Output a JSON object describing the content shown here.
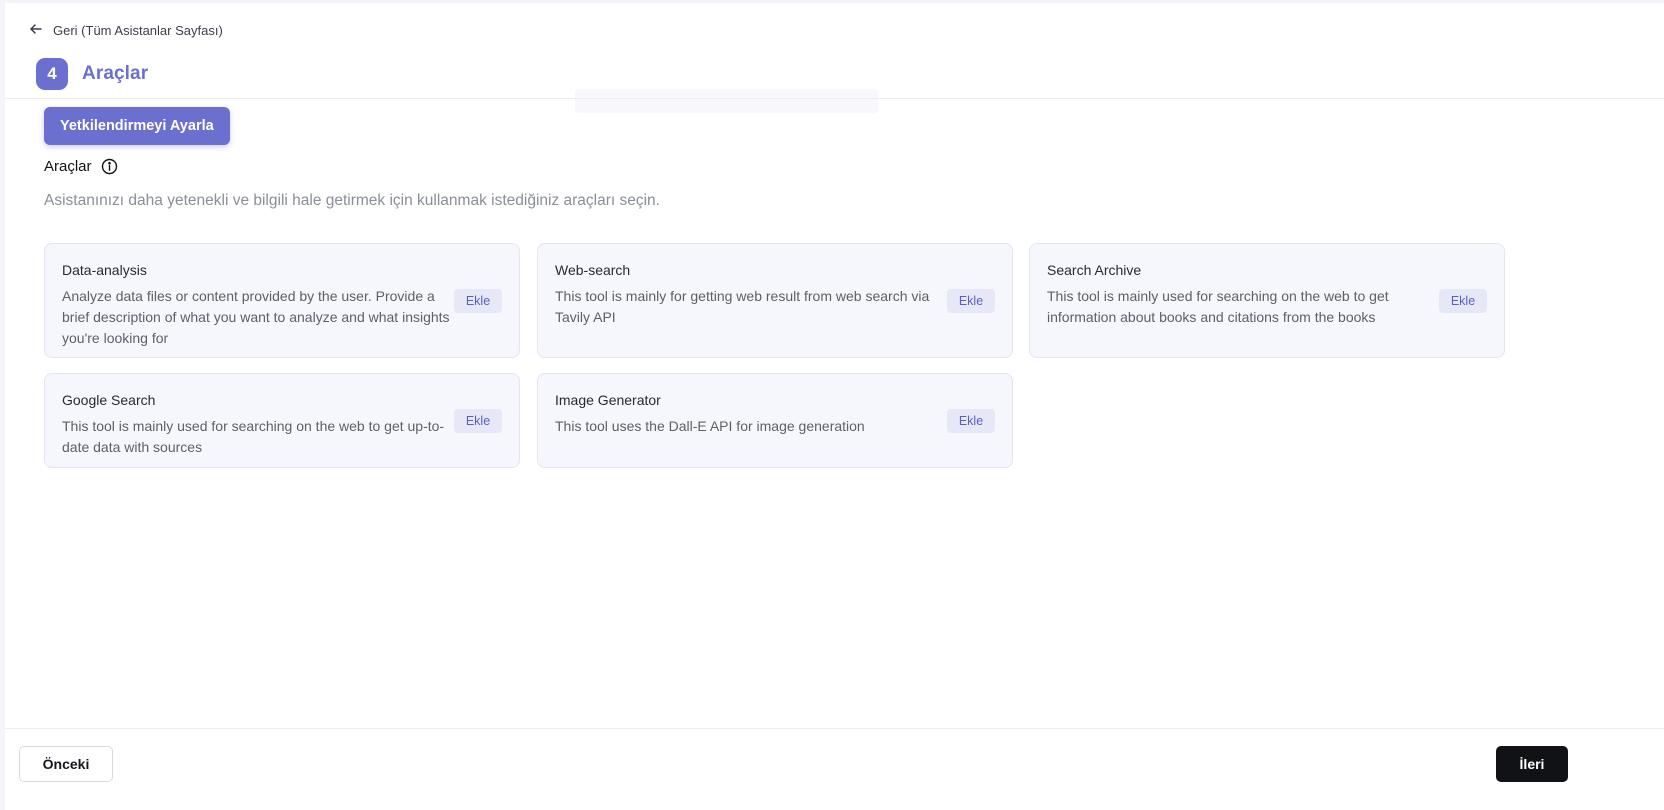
{
  "nav": {
    "back_label": "Geri (Tüm Asistanlar Sayfası)"
  },
  "step": {
    "number": "4",
    "title": "Araçlar"
  },
  "auth_button_label": "Yetkilendirmeyi Ayarla",
  "tools_section": {
    "label": "Araçlar",
    "description": "Asistanınızı daha yetenekli ve bilgili hale getirmek için kullanmak istediğiniz araçları seçin."
  },
  "tools": [
    {
      "name": "Data-analysis",
      "description": "Analyze data files or content provided by the user. Provide a brief description of what you want to analyze and what insights you're looking for",
      "action_label": "Ekle"
    },
    {
      "name": "Web-search",
      "description": "This tool is mainly for getting web result from web search via Tavily API",
      "action_label": "Ekle"
    },
    {
      "name": "Search Archive",
      "description": "This tool is mainly used for searching on the web to get information about books and citations from the books",
      "action_label": "Ekle"
    },
    {
      "name": "Google Search",
      "description": "This tool is mainly used for searching on the web to get up-to-date data with sources",
      "action_label": "Ekle"
    },
    {
      "name": "Image Generator",
      "description": "This tool uses the Dall-E API for image generation",
      "action_label": "Ekle"
    }
  ],
  "footer": {
    "prev_label": "Önceki",
    "next_label": "İleri"
  },
  "colors": {
    "accent": "#6b6fcf",
    "card_bg": "#f6f7fd",
    "add_button_bg": "#e6e8f8",
    "primary_dark": "#111216"
  },
  "icons": {
    "back": "arrow-left-icon",
    "info": "info-circle-icon"
  }
}
